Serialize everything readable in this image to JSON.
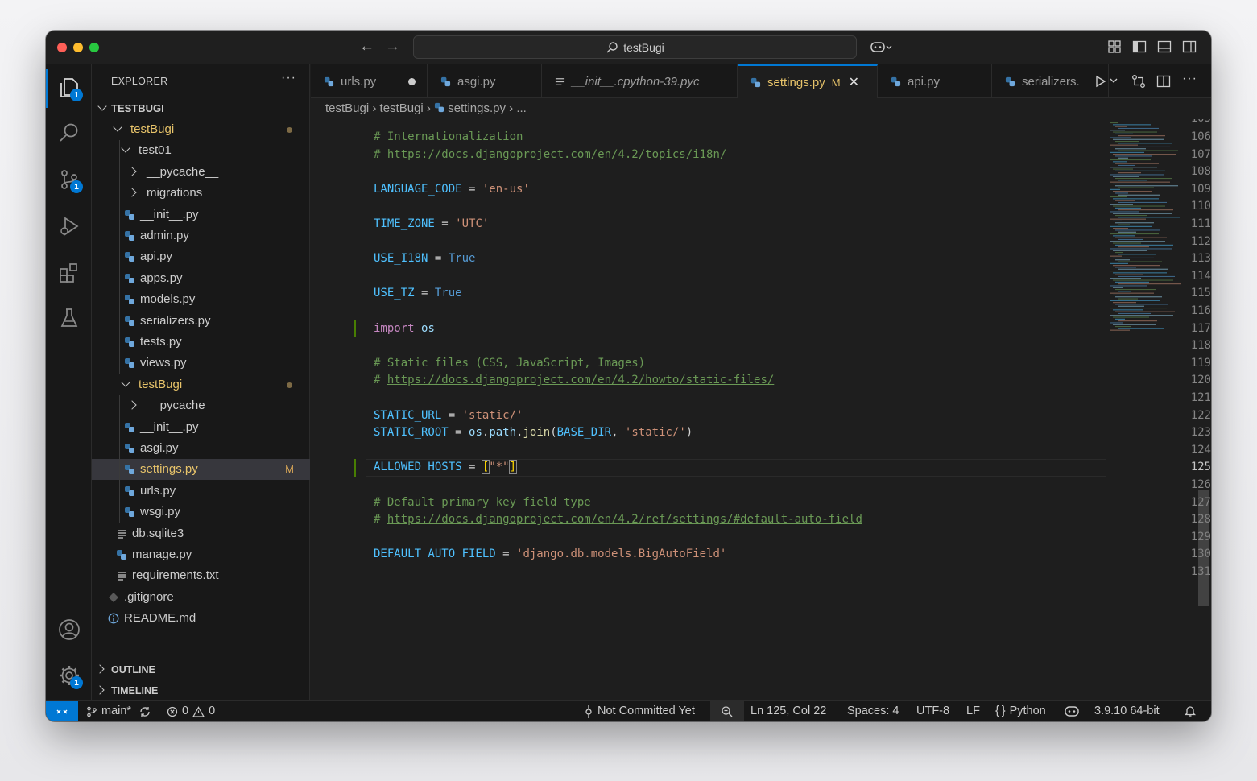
{
  "window": {
    "search": "testBugi"
  },
  "explorer": {
    "title": "EXPLORER",
    "root": "TESTBUGI",
    "outline": "OUTLINE",
    "timeline": "TIMELINE",
    "items": [
      {
        "label": "testBugi",
        "depth": 1,
        "kind": "folder-open",
        "dot": true
      },
      {
        "label": "test01",
        "depth": 2,
        "kind": "folder-open"
      },
      {
        "label": "__pycache__",
        "depth": 3,
        "kind": "folder"
      },
      {
        "label": "migrations",
        "depth": 3,
        "kind": "folder"
      },
      {
        "label": "__init__.py",
        "depth": 3,
        "kind": "py"
      },
      {
        "label": "admin.py",
        "depth": 3,
        "kind": "py"
      },
      {
        "label": "api.py",
        "depth": 3,
        "kind": "py"
      },
      {
        "label": "apps.py",
        "depth": 3,
        "kind": "py"
      },
      {
        "label": "models.py",
        "depth": 3,
        "kind": "py"
      },
      {
        "label": "serializers.py",
        "depth": 3,
        "kind": "py"
      },
      {
        "label": "tests.py",
        "depth": 3,
        "kind": "py"
      },
      {
        "label": "views.py",
        "depth": 3,
        "kind": "py"
      },
      {
        "label": "testBugi",
        "depth": 2,
        "kind": "folder-open",
        "dot": true
      },
      {
        "label": "__pycache__",
        "depth": 3,
        "kind": "folder"
      },
      {
        "label": "__init__.py",
        "depth": 3,
        "kind": "py"
      },
      {
        "label": "asgi.py",
        "depth": 3,
        "kind": "py"
      },
      {
        "label": "settings.py",
        "depth": 3,
        "kind": "py",
        "selected": true,
        "flag": "M"
      },
      {
        "label": "urls.py",
        "depth": 3,
        "kind": "py"
      },
      {
        "label": "wsgi.py",
        "depth": 3,
        "kind": "py"
      },
      {
        "label": "db.sqlite3",
        "depth": 2,
        "kind": "txt"
      },
      {
        "label": "manage.py",
        "depth": 2,
        "kind": "py"
      },
      {
        "label": "requirements.txt",
        "depth": 2,
        "kind": "txt"
      },
      {
        "label": ".gitignore",
        "depth": 1,
        "kind": "git"
      },
      {
        "label": "README.md",
        "depth": 1,
        "kind": "info"
      }
    ]
  },
  "tabs": [
    {
      "label": "urls.py",
      "icon": "python-icon",
      "dot": true
    },
    {
      "label": "asgi.py",
      "icon": "python-icon"
    },
    {
      "label": "__init__.cpython-39.pyc",
      "icon": "lines-icon",
      "italic": true
    },
    {
      "label": "settings.py",
      "icon": "python-icon",
      "active": true,
      "flag": "M"
    },
    {
      "label": "api.py",
      "icon": "python-icon"
    },
    {
      "label": "serializers.",
      "icon": "python-icon"
    }
  ],
  "breadcrumb": {
    "p1": "testBugi",
    "p2": "testBugi",
    "p3": "settings.py",
    "p4": "..."
  },
  "code": {
    "top_partial": "105",
    "lines": [
      {
        "n": "106",
        "t": [
          [
            "c",
            "# Internationalization"
          ]
        ]
      },
      {
        "n": "107",
        "t": [
          [
            "c",
            "# "
          ],
          [
            "u",
            "https://docs.djangoproject.com/en/4.2/topics/i18n/"
          ]
        ]
      },
      {
        "n": "108",
        "t": []
      },
      {
        "n": "109",
        "t": [
          [
            "v",
            "LANGUAGE_CODE"
          ],
          [
            "o",
            " = "
          ],
          [
            "s",
            "'en-us'"
          ]
        ]
      },
      {
        "n": "110",
        "t": []
      },
      {
        "n": "111",
        "t": [
          [
            "v",
            "TIME_ZONE"
          ],
          [
            "o",
            " = "
          ],
          [
            "s",
            "'UTC'"
          ]
        ]
      },
      {
        "n": "112",
        "t": []
      },
      {
        "n": "113",
        "t": [
          [
            "v",
            "USE_I18N"
          ],
          [
            "o",
            " = "
          ],
          [
            "k",
            "True"
          ]
        ]
      },
      {
        "n": "114",
        "t": []
      },
      {
        "n": "115",
        "t": [
          [
            "v",
            "USE_TZ"
          ],
          [
            "o",
            " = "
          ],
          [
            "k",
            "True"
          ]
        ]
      },
      {
        "n": "116",
        "t": []
      },
      {
        "n": "117",
        "t": [
          [
            "kw",
            "import"
          ],
          [
            "o",
            " "
          ],
          [
            "n",
            "os"
          ]
        ],
        "git": true
      },
      {
        "n": "118",
        "t": []
      },
      {
        "n": "119",
        "t": [
          [
            "c",
            "# Static files (CSS, JavaScript, Images)"
          ]
        ]
      },
      {
        "n": "120",
        "t": [
          [
            "c",
            "# "
          ],
          [
            "u",
            "https://docs.djangoproject.com/en/4.2/howto/static-files/"
          ]
        ]
      },
      {
        "n": "121",
        "t": []
      },
      {
        "n": "122",
        "t": [
          [
            "v",
            "STATIC_URL"
          ],
          [
            "o",
            " = "
          ],
          [
            "s",
            "'static/'"
          ]
        ]
      },
      {
        "n": "123",
        "t": [
          [
            "v",
            "STATIC_ROOT"
          ],
          [
            "o",
            " = "
          ],
          [
            "n",
            "os"
          ],
          [
            "o",
            "."
          ],
          [
            "n",
            "path"
          ],
          [
            "o",
            "."
          ],
          [
            "f",
            "join"
          ],
          [
            "o",
            "("
          ],
          [
            "v",
            "BASE_DIR"
          ],
          [
            "o",
            ", "
          ],
          [
            "s",
            "'static/'"
          ],
          [
            "o",
            ")"
          ]
        ]
      },
      {
        "n": "124",
        "t": []
      },
      {
        "n": "125",
        "t": [
          [
            "v",
            "ALLOWED_HOSTS"
          ],
          [
            "o",
            " = "
          ],
          [
            "o",
            "["
          ],
          [
            "s",
            "\"*\""
          ],
          [
            "o",
            "]"
          ]
        ],
        "current": true,
        "git": true
      },
      {
        "n": "126",
        "t": []
      },
      {
        "n": "127",
        "t": [
          [
            "c",
            "# Default primary key field type"
          ]
        ]
      },
      {
        "n": "128",
        "t": [
          [
            "c",
            "# "
          ],
          [
            "u",
            "https://docs.djangoproject.com/en/4.2/ref/settings/#default-auto-field"
          ]
        ]
      },
      {
        "n": "129",
        "t": []
      },
      {
        "n": "130",
        "t": [
          [
            "v",
            "DEFAULT_AUTO_FIELD"
          ],
          [
            "o",
            " = "
          ],
          [
            "s",
            "'django.db.models.BigAutoField'"
          ]
        ]
      },
      {
        "n": "131",
        "t": []
      }
    ]
  },
  "status": {
    "branch": "main*",
    "errors": "0",
    "warnings": "0",
    "commit": "Not Committed Yet",
    "position": "Ln 125, Col 22",
    "spaces": "Spaces: 4",
    "encoding": "UTF-8",
    "eol": "LF",
    "language": "Python",
    "interpreter": "3.9.10 64-bit"
  },
  "badges": {
    "explorer": "1",
    "scm": "1",
    "settings": "1"
  },
  "colors": {
    "accent": "#0078d4",
    "modified": "#e8c46a",
    "git_added": "#487e02"
  }
}
